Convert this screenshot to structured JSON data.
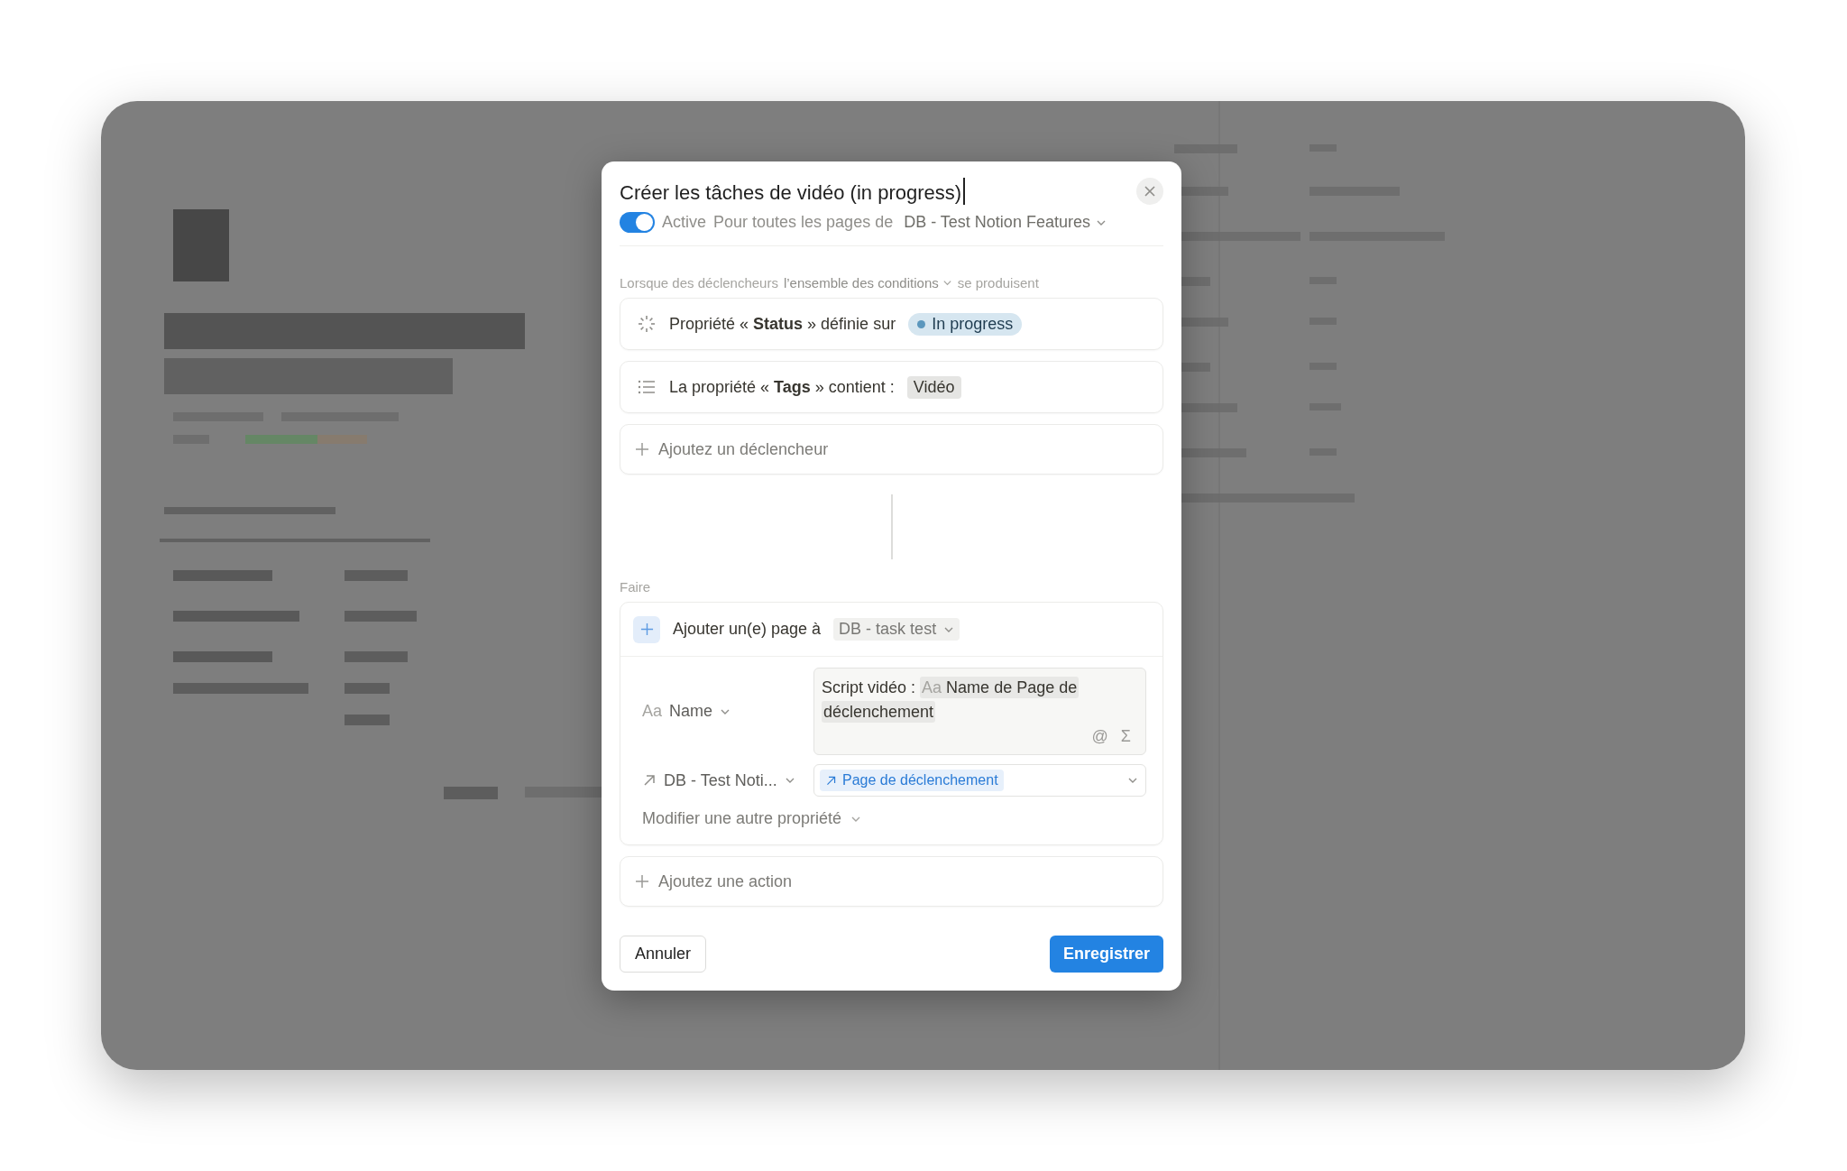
{
  "automation": {
    "title": "Créer les tâches de vidéo (in progress)",
    "active": true,
    "active_label": "Active",
    "scope_label": "Pour toutes les pages de",
    "database": "DB - Test Notion Features"
  },
  "triggers": {
    "label_start": "Lorsque des déclencheurs",
    "condition_mode": "l’ensemble des conditions",
    "label_end": "se produisent",
    "items": [
      {
        "kind": "status",
        "text": "Propriété « **Status** » définie sur",
        "value": "In progress"
      },
      {
        "kind": "tags",
        "text": "La propriété « **Tags** » contient :",
        "value": "Vidéo"
      }
    ],
    "add": "Ajoutez un déclencheur"
  },
  "actions": {
    "label": "Faire",
    "items": [
      {
        "kind": "add_page",
        "text": "Ajouter un(e) page à",
        "database": "DB - task test",
        "properties": [
          {
            "kind": "title",
            "type_label": "Aa",
            "name": "Name",
            "value_text": "Script vidéo :",
            "mention_type": "Aa",
            "mention": "Name de Page de déclenchement",
            "field_icons": [
              "@",
              "Σ"
            ]
          },
          {
            "kind": "relation",
            "name": "DB - Test Noti...",
            "chip": "Page de déclenchement"
          }
        ],
        "more": "Modifier une autre propriété"
      }
    ],
    "add": "Ajoutez une action"
  },
  "buttons": {
    "cancel": "Annuler",
    "save": "Enregistrer"
  }
}
